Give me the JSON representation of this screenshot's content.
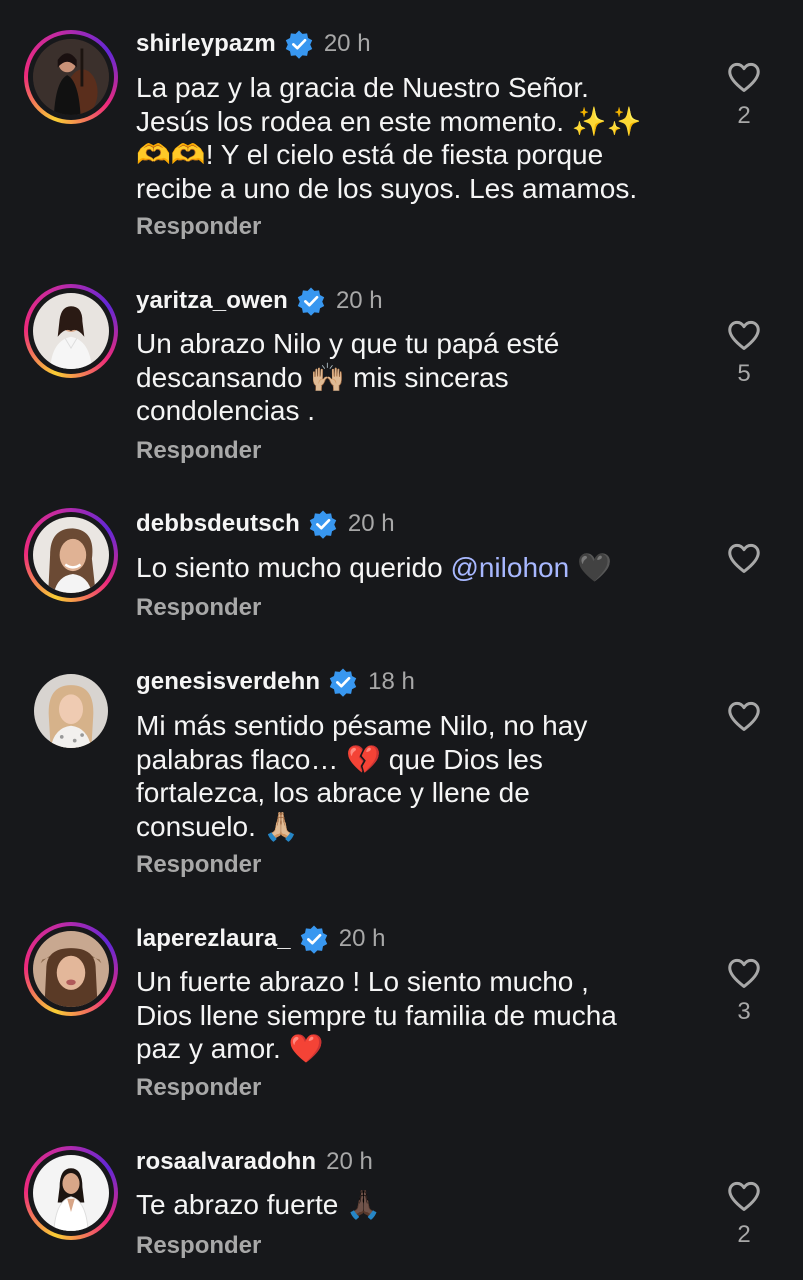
{
  "reply_label": "Responder",
  "colors": {
    "background": "#17181b",
    "verified_badge": "#3897f0",
    "mention": "#a8b8ff",
    "secondary_text": "#a8a8a8"
  },
  "comments": [
    {
      "username": "shirleypazm",
      "verified": true,
      "time": "20 h",
      "has_story_ring": true,
      "lines": [
        "La paz y la gracia de Nuestro Señor.",
        "Jesús los rodea en este momento. ✨✨",
        "🫶🫶! Y el cielo está de fiesta porque",
        "recibe a uno de los suyos. Les amamos."
      ],
      "likes": "2"
    },
    {
      "username": "yaritza_owen",
      "verified": true,
      "time": "20 h",
      "has_story_ring": true,
      "lines": [
        "Un abrazo Nilo y que tu papá esté",
        "descansando 🙌🏼 mis sinceras",
        "condolencias ."
      ],
      "likes": "5"
    },
    {
      "username": "debbsdeutsch",
      "verified": true,
      "time": "20 h",
      "has_story_ring": true,
      "text_before_mention": "Lo siento mucho querido ",
      "mention": "@nilohon",
      "text_after_mention": " 🖤",
      "likes": ""
    },
    {
      "username": "genesisverdehn",
      "verified": true,
      "time": "18 h",
      "has_story_ring": false,
      "lines": [
        "Mi más sentido pésame Nilo, no hay",
        "palabras flaco… 💔 que Dios les",
        "fortalezca, los abrace y llene de",
        "consuelo. 🙏🏼"
      ],
      "likes": ""
    },
    {
      "username": "laperezlaura_",
      "verified": true,
      "time": "20 h",
      "has_story_ring": true,
      "lines": [
        "Un fuerte abrazo ! Lo siento  mucho ,",
        "Dios llene siempre tu familia de mucha",
        "paz y amor. ❤️"
      ],
      "likes": "3"
    },
    {
      "username": "rosaalvaradohn",
      "verified": false,
      "time": "20 h",
      "has_story_ring": true,
      "lines": [
        "Te abrazo fuerte 🙏🏿"
      ],
      "likes": "2"
    }
  ]
}
